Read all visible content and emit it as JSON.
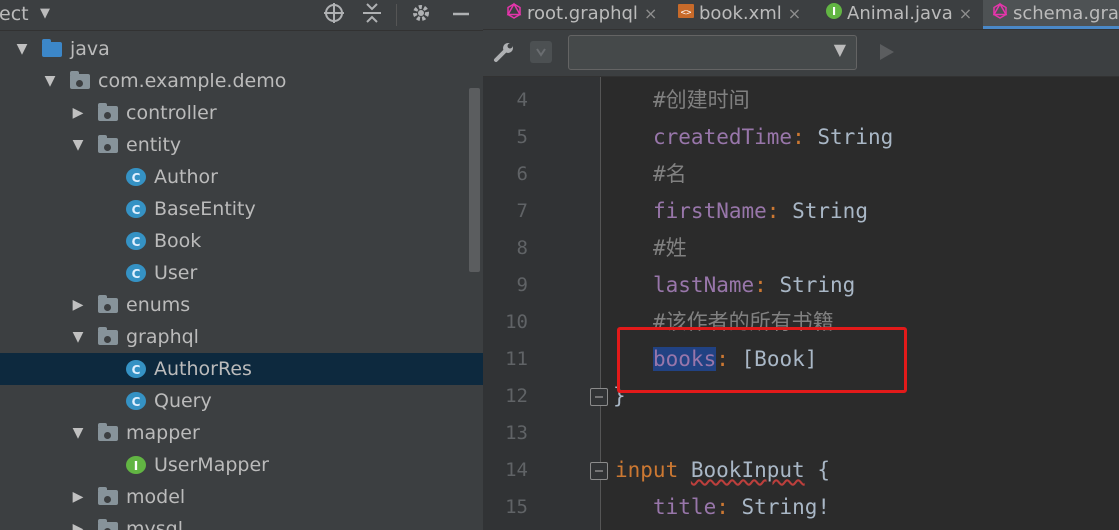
{
  "project_panel": {
    "title": "ect",
    "tree": [
      {
        "label": "java",
        "kind": "folder-blue",
        "level": 0,
        "expanded": true
      },
      {
        "label": "com.example.demo",
        "kind": "package",
        "level": 1,
        "expanded": true
      },
      {
        "label": "controller",
        "kind": "package",
        "level": 2,
        "expanded": false
      },
      {
        "label": "entity",
        "kind": "package",
        "level": 2,
        "expanded": true
      },
      {
        "label": "Author",
        "kind": "class",
        "level": 3
      },
      {
        "label": "BaseEntity",
        "kind": "class",
        "level": 3
      },
      {
        "label": "Book",
        "kind": "class",
        "level": 3
      },
      {
        "label": "User",
        "kind": "class",
        "level": 3
      },
      {
        "label": "enums",
        "kind": "package",
        "level": 2,
        "expanded": false
      },
      {
        "label": "graphql",
        "kind": "package",
        "level": 2,
        "expanded": true
      },
      {
        "label": "AuthorRes",
        "kind": "class",
        "level": 3,
        "selected": true
      },
      {
        "label": "Query",
        "kind": "class",
        "level": 3
      },
      {
        "label": "mapper",
        "kind": "package",
        "level": 2,
        "expanded": true
      },
      {
        "label": "UserMapper",
        "kind": "interface",
        "level": 3
      },
      {
        "label": "model",
        "kind": "package",
        "level": 2,
        "expanded": false
      },
      {
        "label": "mysql",
        "kind": "package",
        "level": 2,
        "expanded": false
      }
    ]
  },
  "tabs": [
    {
      "label": "root.graphql",
      "icon": "graphql-icon"
    },
    {
      "label": "book.xml",
      "icon": "xml-icon"
    },
    {
      "label": "Animal.java",
      "icon": "interface-icon"
    },
    {
      "label": "schema.grap",
      "icon": "graphql-icon",
      "active": true
    }
  ],
  "tab_close_glyph": "×",
  "editor": {
    "lines": [
      {
        "num": "4",
        "text": "#创建时间"
      },
      {
        "num": "5",
        "field": "createdTime",
        "type": "String"
      },
      {
        "num": "6",
        "text": "#名"
      },
      {
        "num": "7",
        "field": "firstName",
        "type": "String"
      },
      {
        "num": "8",
        "text": "#姓"
      },
      {
        "num": "9",
        "field": "lastName",
        "type": "String"
      },
      {
        "num": "10",
        "text": "#该作者的所有书籍"
      },
      {
        "num": "11",
        "field": "books",
        "type": "[Book]"
      },
      {
        "num": "12",
        "text": "}"
      },
      {
        "num": "13",
        "text": ""
      },
      {
        "num": "14",
        "keyword": "input",
        "name": "BookInput",
        "brace": "{"
      },
      {
        "num": "15",
        "field": "title",
        "type": "String!"
      }
    ]
  },
  "colors": {
    "highlight_box": "#e21a1a",
    "selection": "#214283",
    "comment": "#808080",
    "field": "#9876aa",
    "keyword": "#cc7832"
  }
}
